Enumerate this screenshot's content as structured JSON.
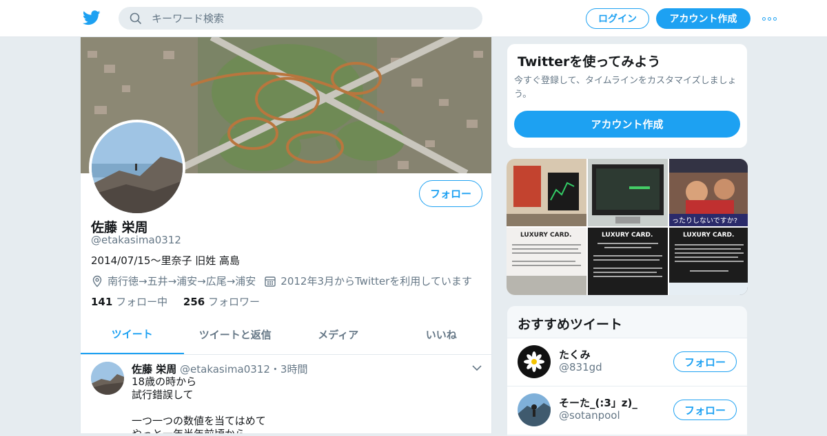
{
  "search": {
    "placeholder": "キーワード検索"
  },
  "header": {
    "login_label": "ログイン",
    "signup_label": "アカウント作成"
  },
  "profile": {
    "name": "佐藤 栄周",
    "handle": "@etakasima0312",
    "bio": "2014/07/15〜里奈子 旧姓 高島",
    "location": "南行徳→五井→浦安→広尾→浦安",
    "joined": "2012年3月からTwitterを利用しています",
    "following_count": "141",
    "following_label": "フォロー中",
    "followers_count": "256",
    "followers_label": "フォロワー",
    "follow_label": "フォロー"
  },
  "tabs": [
    {
      "label": "ツイート"
    },
    {
      "label": "ツイートと返信"
    },
    {
      "label": "メディア"
    },
    {
      "label": "いいね"
    }
  ],
  "tweet": {
    "name": "佐藤 栄周",
    "handle": "@etakasima0312",
    "separator": "・",
    "time": "3時間",
    "text": "18歳の時から\n試行錯誤して\n\n一つ一つの数値を当てはめて\nやっと一年半年前頃から"
  },
  "signup_card": {
    "title": "Twitterを使ってみよう",
    "description": "今すぐ登録して、タイムラインをカスタマイズしましょう。",
    "button_label": "アカウント作成"
  },
  "media_grid": {
    "luxury_text": "LUXURY CARD.",
    "caption": "ったりしないですか?"
  },
  "recommended": {
    "title": "おすすめツイート",
    "users": [
      {
        "name": "たくみ",
        "handle": "@831gd",
        "follow_label": "フォロー"
      },
      {
        "name": "そーた_(:3」z)_",
        "handle": "@sotanpool",
        "follow_label": "フォロー"
      }
    ]
  },
  "colors": {
    "accent": "#1da1f2",
    "background": "#e6ecf0",
    "secondary_text": "#657786"
  }
}
